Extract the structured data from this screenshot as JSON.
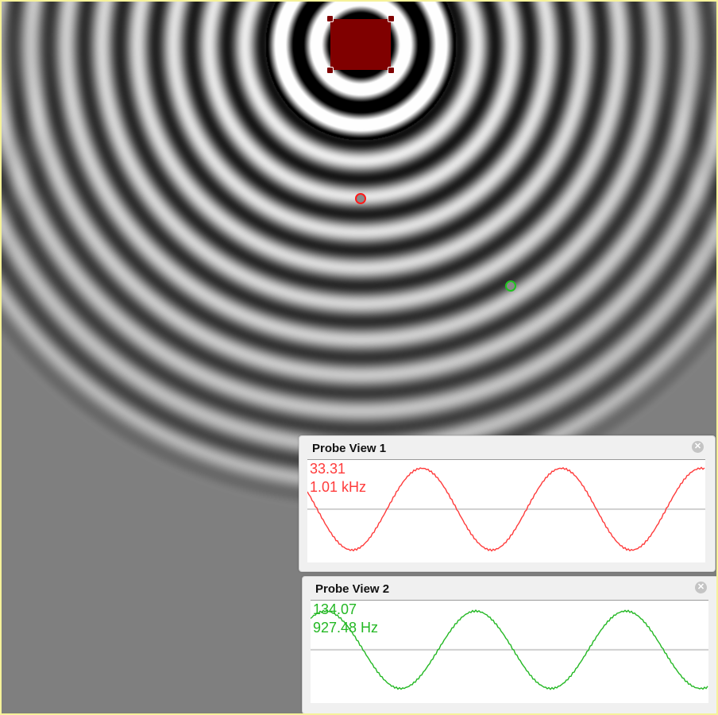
{
  "colors": {
    "source": "#800000",
    "probe1": "#ff3b3b",
    "probe2": "#24b824",
    "frame_border": "#f6f29a",
    "background_gray": "#7f7f7f"
  },
  "simulation": {
    "source_label": "",
    "probe_markers": [
      {
        "name": "probe-1",
        "color": "red"
      },
      {
        "name": "probe-2",
        "color": "green"
      }
    ]
  },
  "probe_views": [
    {
      "title": "Probe View 1",
      "value": "33.31",
      "frequency": "1.01 kHz",
      "close_icon": "close-icon",
      "chart_data": {
        "type": "line",
        "series": [
          {
            "color": "#ff3b3b",
            "phase_start": 0.18,
            "cycles": 2.85,
            "amplitude": 0.95
          }
        ],
        "ylim": [
          -1,
          1
        ]
      }
    },
    {
      "title": "Probe View 2",
      "value": "134.07",
      "frequency": "927.48 Hz",
      "close_icon": "close-icon",
      "chart_data": {
        "type": "line",
        "series": [
          {
            "color": "#24b824",
            "phase_start": -0.1,
            "cycles": 2.65,
            "amplitude": 0.9
          }
        ],
        "ylim": [
          -1,
          1
        ]
      }
    }
  ]
}
